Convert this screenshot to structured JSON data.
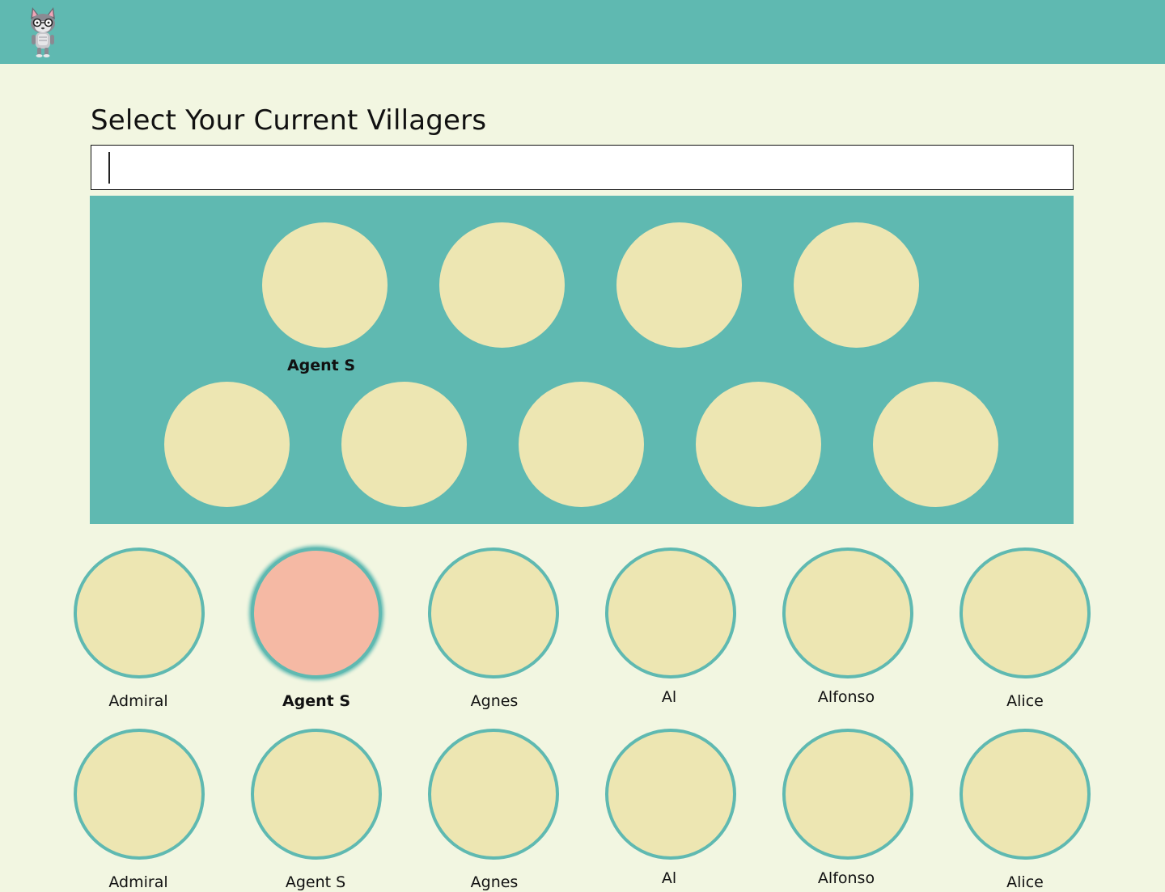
{
  "header": {
    "logo_icon": "cat-villager-logo-icon"
  },
  "page": {
    "title": "Select Your Current Villagers"
  },
  "search": {
    "value": "",
    "placeholder": ""
  },
  "selected": {
    "slot_count": 9,
    "labels": [
      "Agent S",
      "",
      "",
      "",
      "",
      "",
      "",
      "",
      ""
    ]
  },
  "villagers": {
    "row1": [
      "Admiral",
      "Agent S",
      "Agnes",
      "Al",
      "Alfonso",
      "Alice"
    ],
    "row2": [
      "Admiral",
      "Agent S",
      "Agnes",
      "Al",
      "Alfonso",
      "Alice"
    ],
    "highlighted": "Agent S"
  },
  "colors": {
    "header_bg": "#5fb9b1",
    "page_bg": "#f2f6e1",
    "circle_fill": "#ede6b2",
    "circle_border": "#5fb9b1",
    "circle_active": "#f5b9a4"
  }
}
